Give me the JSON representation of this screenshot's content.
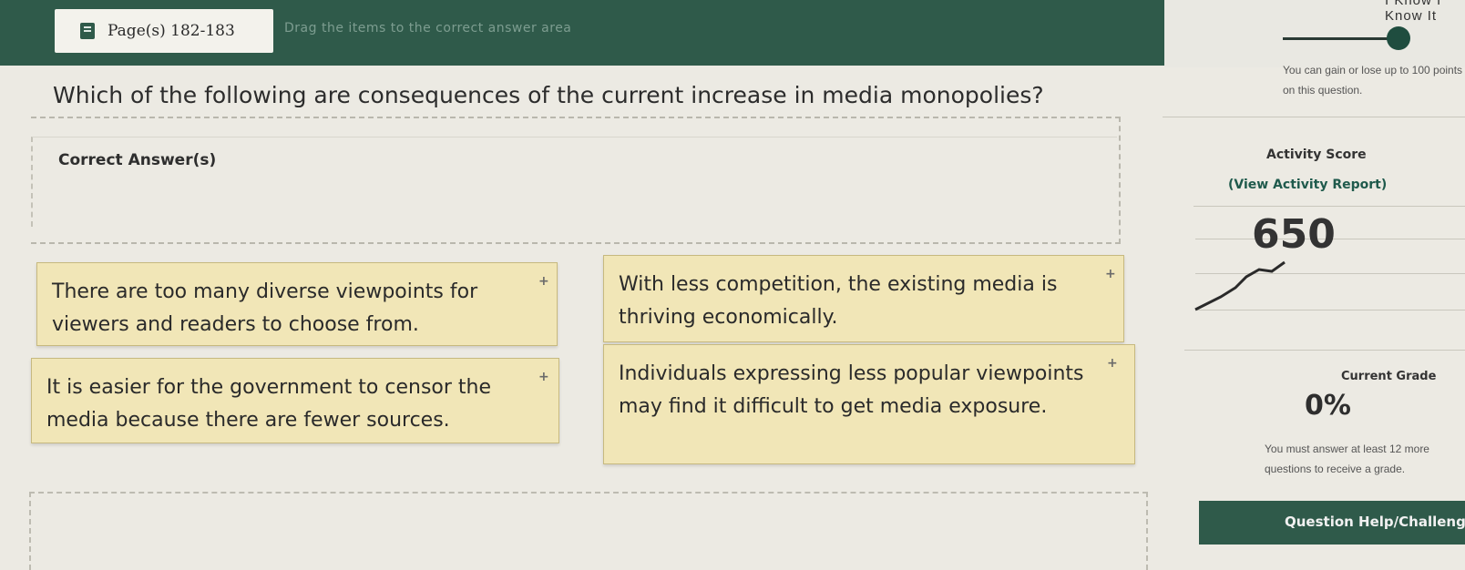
{
  "header": {
    "page_label": "Page(s) 182-183",
    "blurred_instruction": "Drag the items to the correct answer area",
    "know_label": "I Know I Know It"
  },
  "question": {
    "text": "Which of the following are consequences of the current increase in media monopolies?",
    "gain_note": "You can gain or lose up to 100 points on this question."
  },
  "answer_area": {
    "label": "Correct Answer(s)"
  },
  "options": [
    {
      "text": "There are too many diverse viewpoints for viewers and readers to choose from.",
      "plus": "+"
    },
    {
      "text": "With less competition, the existing media is thriving economically.",
      "plus": "+"
    },
    {
      "text": "It is easier for the government to censor the media because there are fewer sources.",
      "plus": "+"
    },
    {
      "text": "Individuals expressing less popular viewpoints may find it difficult to get media exposure.",
      "plus": "+"
    }
  ],
  "sidebar": {
    "activity_score_label": "Activity Score",
    "activity_report_link": "(View Activity Report)",
    "score": "650",
    "current_grade_label": "Current Grade",
    "grade_value": "0%",
    "grade_note": "You must answer at least 12 more questions to receive a grade.",
    "help_label": "Question Help/Challenge"
  },
  "colors": {
    "header_green": "#2f5a4a",
    "option_fill": "#f1e6b7",
    "link_green": "#1f5a4c"
  }
}
